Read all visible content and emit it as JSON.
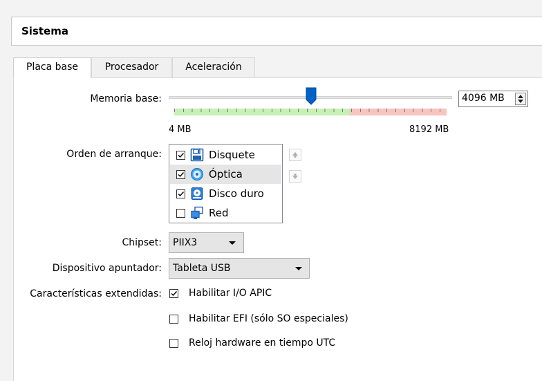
{
  "section_title": "Sistema",
  "tabs": [
    {
      "label": "Placa base",
      "active": true
    },
    {
      "label": "Procesador",
      "active": false
    },
    {
      "label": "Aceleración",
      "active": false
    }
  ],
  "memory": {
    "label": "Memoria base:",
    "value": "4096 MB",
    "value_mb": 4096,
    "min_label": "4 MB",
    "max_label": "8192 MB",
    "min_mb": 4,
    "max_mb": 8192
  },
  "boot_order": {
    "label": "Orden de arranque:",
    "items": [
      {
        "label": "Disquete",
        "checked": true,
        "icon": "floppy-icon"
      },
      {
        "label": "Óptica",
        "checked": true,
        "icon": "optical-disc-icon"
      },
      {
        "label": "Disco duro",
        "checked": true,
        "icon": "hard-disk-icon"
      },
      {
        "label": "Red",
        "checked": false,
        "icon": "network-icon"
      }
    ],
    "selected_index": 1
  },
  "chipset": {
    "label": "Chipset:",
    "value": "PIIX3"
  },
  "pointing_device": {
    "label": "Dispositivo apuntador:",
    "value": "Tableta USB"
  },
  "extended": {
    "label": "Características extendidas:",
    "options": [
      {
        "label": "Habilitar I/O APIC",
        "checked": true
      },
      {
        "label": "Habilitar EFI (sólo SO especiales)",
        "checked": false
      },
      {
        "label": "Reloj hardware en tiempo UTC",
        "checked": false
      }
    ]
  },
  "colors": {
    "accent": "#0062c6",
    "scale_ok": "#c6f0b4",
    "scale_warn": "#f8c4c0"
  }
}
